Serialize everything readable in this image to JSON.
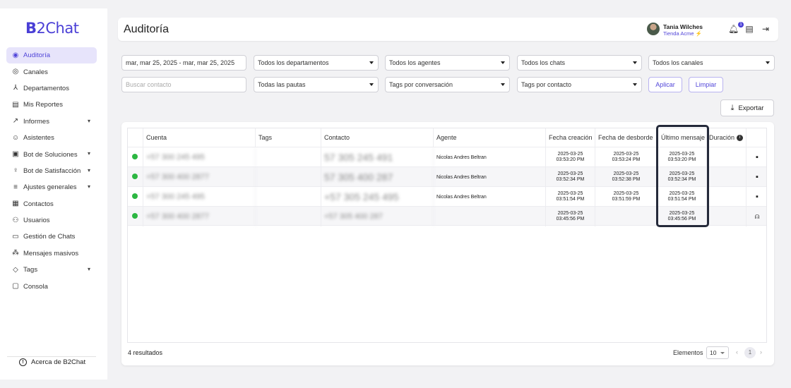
{
  "app": {
    "logo_b": "B",
    "logo_rest": "2Chat"
  },
  "sidebar": {
    "items": [
      {
        "label": "Auditoría",
        "icon": "check-circle-icon",
        "active": true,
        "expandable": false
      },
      {
        "label": "Canales",
        "icon": "broadcast-icon",
        "active": false,
        "expandable": false
      },
      {
        "label": "Departamentos",
        "icon": "hierarchy-icon",
        "active": false,
        "expandable": false
      },
      {
        "label": "Mis Reportes",
        "icon": "report-icon",
        "active": false,
        "expandable": false
      },
      {
        "label": "Informes",
        "icon": "trend-icon",
        "active": false,
        "expandable": true
      },
      {
        "label": "Asistentes",
        "icon": "robot-icon",
        "active": false,
        "expandable": false
      },
      {
        "label": "Bot de Soluciones",
        "icon": "bot-icon",
        "active": false,
        "expandable": true
      },
      {
        "label": "Bot de Satisfacción",
        "icon": "bulb-icon",
        "active": false,
        "expandable": true
      },
      {
        "label": "Ajustes generales",
        "icon": "sliders-icon",
        "active": false,
        "expandable": true
      },
      {
        "label": "Contactos",
        "icon": "contacts-icon",
        "active": false,
        "expandable": false
      },
      {
        "label": "Usuarios",
        "icon": "users-icon",
        "active": false,
        "expandable": false
      },
      {
        "label": "Gestión de Chats",
        "icon": "chats-icon",
        "active": false,
        "expandable": false
      },
      {
        "label": "Mensajes masivos",
        "icon": "broadcast-messages-icon",
        "active": false,
        "expandable": false
      },
      {
        "label": "Tags",
        "icon": "tag-icon",
        "active": false,
        "expandable": true
      },
      {
        "label": "Consola",
        "icon": "console-icon",
        "active": false,
        "expandable": false
      }
    ],
    "about": "Acerca de B2Chat"
  },
  "header": {
    "title": "Auditoría",
    "user_name": "Tania Wilches",
    "user_org": "Tienda Acme",
    "user_org_badge": "⚡",
    "notif_count": "1"
  },
  "filters": {
    "date_range": "mar, mar 25, 2025 - mar, mar 25, 2025",
    "departments": "Todos los departamentos",
    "agents": "Todos los agentes",
    "chats": "Todos los chats",
    "channels": "Todos los canales",
    "search_placeholder": "Buscar contacto",
    "guidelines": "Todas las pautas",
    "conversation_tags": "Tags por conversación",
    "contact_tags": "Tags por contacto",
    "apply": "Aplicar",
    "clear": "Limpiar",
    "export": "Exportar"
  },
  "table": {
    "columns": [
      "Cuenta",
      "Tags",
      "Contacto",
      "Agente",
      "Fecha creación",
      "Fecha de desborde",
      "Último mensaje",
      "Duración"
    ],
    "rows": [
      {
        "cuenta": "+57 300 245 495",
        "tags": "",
        "contacto": "57 305 245 491",
        "agente": "Nicolas Andres Beltran",
        "creacion_date": "2025-03-25",
        "creacion_time": "03:53:20 PM",
        "desborde_date": "2025-03-25",
        "desborde_time": "03:53:24 PM",
        "ultimo_date": "2025-03-25",
        "ultimo_time": "03:53:20 PM",
        "duracion": "",
        "action_icon": "chat-bubble-icon"
      },
      {
        "cuenta": "+57 300 400 2877",
        "tags": "",
        "contacto": "57 305 400 287",
        "agente": "Nicolas Andres Beltran",
        "creacion_date": "2025-03-25",
        "creacion_time": "03:52:34 PM",
        "desborde_date": "2025-03-25",
        "desborde_time": "03:52:38 PM",
        "ultimo_date": "2025-03-25",
        "ultimo_time": "03:52:34 PM",
        "duracion": "",
        "action_icon": "chat-bubble-icon"
      },
      {
        "cuenta": "+57 300 245 495",
        "tags": "",
        "contacto": "+57 305 245 495",
        "agente": "Nicolas Andres Beltran",
        "creacion_date": "2025-03-25",
        "creacion_time": "03:51:54 PM",
        "desborde_date": "2025-03-25",
        "desborde_time": "03:51:59 PM",
        "ultimo_date": "2025-03-25",
        "ultimo_time": "03:51:54 PM",
        "duracion": "",
        "action_icon": "chat-bubble-icon"
      },
      {
        "cuenta": "+57 300 400 2877",
        "tags": "",
        "contacto": "+57 305 400 287",
        "agente": "",
        "creacion_date": "2025-03-25",
        "creacion_time": "03:45:56 PM",
        "desborde_date": "",
        "desborde_time": "",
        "ultimo_date": "2025-03-25",
        "ultimo_time": "03:45:56 PM",
        "duracion": "",
        "action_icon": "bot-icon"
      }
    ]
  },
  "footer": {
    "results": "4 resultados",
    "elements_label": "Elementos",
    "page_size": "10",
    "current_page": "1"
  },
  "colors": {
    "accent": "#4a3fd6",
    "whatsapp": "#2cb742",
    "highlight": "#252a3a"
  }
}
